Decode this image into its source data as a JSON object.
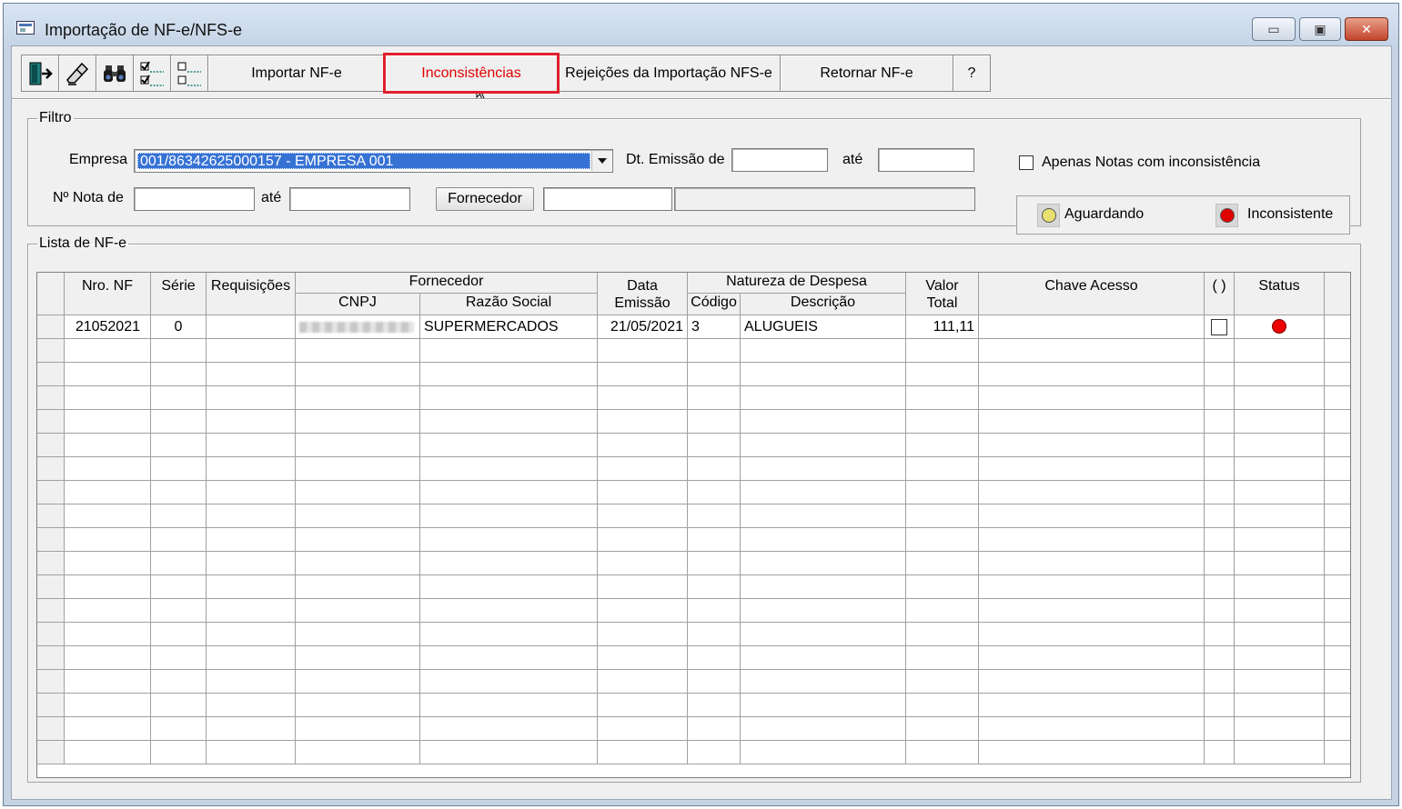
{
  "window": {
    "title": "Importação de NF-e/NFS-e",
    "controls": {
      "minimize": "▭",
      "maximize": "▣",
      "close": "✕"
    }
  },
  "toolbar": {
    "icons": [
      "exit-door-icon",
      "eraser-icon",
      "binoculars-icon",
      "check-all-icon",
      "uncheck-all-icon"
    ],
    "importar": "Importar NF-e",
    "inconsistencias": "Inconsistências",
    "rejeicoes": "Rejeições da Importação NFS-e",
    "retornar": "Retornar NF-e",
    "help": "?"
  },
  "filtro": {
    "legend": "Filtro",
    "empresa_label": "Empresa",
    "empresa_value": "001/86342625000157 - EMPRESA 001",
    "dt_emissao_label": "Dt. Emissão de",
    "ate1": "até",
    "nota_label": "Nº Nota de",
    "ate2": "até",
    "fornecedor_button": "Fornecedor",
    "apenas_label": "Apenas Notas com inconsistência",
    "legend_aguardando": "Aguardando",
    "legend_inconsistente": "Inconsistente",
    "color_aguardando": "#e8e070",
    "color_inconsistente": "#e00000"
  },
  "lista": {
    "legend": "Lista de NF-e",
    "headers": {
      "nro_nf": "Nro. NF",
      "serie": "Série",
      "requisicoes": "Requisições",
      "fornecedor": "Fornecedor",
      "cnpj": "CNPJ",
      "razao_social": "Razão Social",
      "data_emissao_1": "Data",
      "data_emissao_2": "Emissão",
      "natureza": "Natureza de Despesa",
      "codigo": "Código",
      "descricao": "Descrição",
      "valor_1": "Valor",
      "valor_2": "Total",
      "chave": "Chave Acesso",
      "sel": "( )",
      "status": "Status"
    },
    "rows": [
      {
        "nro_nf": "21052021",
        "serie": "0",
        "requisicoes": "",
        "razao_social": "SUPERMERCADOS",
        "data_emissao": "21/05/2021",
        "codigo": "3",
        "descricao": "ALUGUEIS",
        "valor_total": "111,11",
        "chave": "",
        "status": "inconsistente"
      }
    ]
  }
}
